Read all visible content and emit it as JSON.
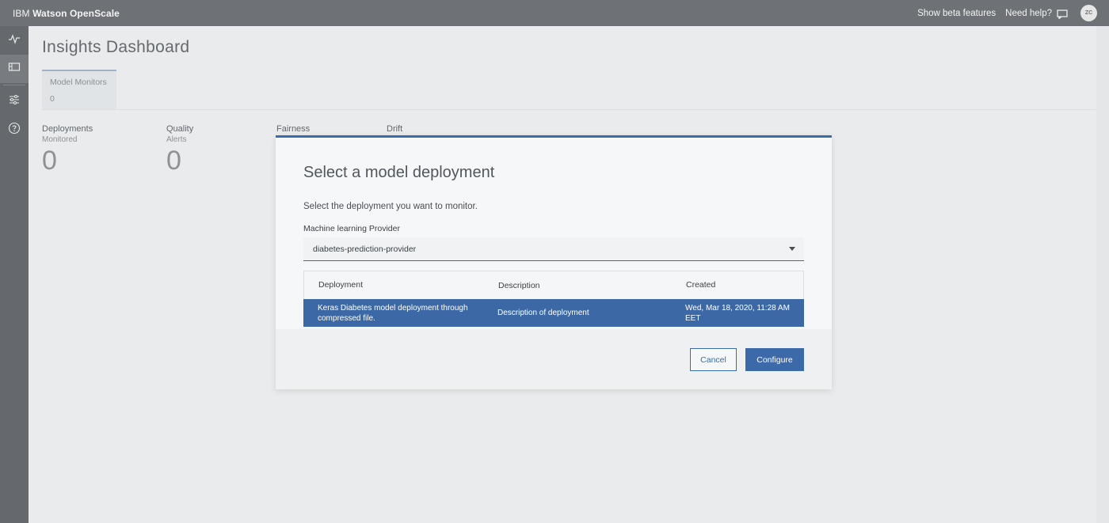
{
  "header": {
    "brand_prefix": "IBM",
    "brand_name": "Watson OpenScale",
    "beta_link": "Show beta features",
    "help_link": "Need help?",
    "avatar_initials": "ZC"
  },
  "sidebar": {
    "items": [
      {
        "icon": "activity-icon",
        "active": false
      },
      {
        "icon": "dashboard-icon",
        "active": true
      },
      {
        "icon": "settings-sliders-icon",
        "active": false
      },
      {
        "icon": "help-icon",
        "active": false
      }
    ]
  },
  "page": {
    "title": "Insights Dashboard",
    "tab_label": "Model Monitors",
    "tab_count": "0",
    "stats": [
      {
        "title": "Deployments",
        "sub": "Monitored",
        "value": "0"
      },
      {
        "title": "Quality",
        "sub": "Alerts",
        "value": "0"
      }
    ],
    "fairness_label": "Fairness",
    "drift_label": "Drift"
  },
  "modal": {
    "title": "Select a model deployment",
    "description": "Select the deployment you want to monitor.",
    "provider_label": "Machine learning Provider",
    "provider_value": "diabetes-prediction-provider",
    "columns": [
      "Deployment",
      "Description",
      "Created"
    ],
    "rows": [
      {
        "deployment": "Keras Diabetes model deployment through compressed file.",
        "description": "Description of deployment",
        "created": "Wed, Mar 18, 2020, 11:28 AM EET"
      }
    ],
    "cancel_label": "Cancel",
    "configure_label": "Configure"
  },
  "colors": {
    "accent": "#3c69a5",
    "header_bg": "#6e7276"
  }
}
